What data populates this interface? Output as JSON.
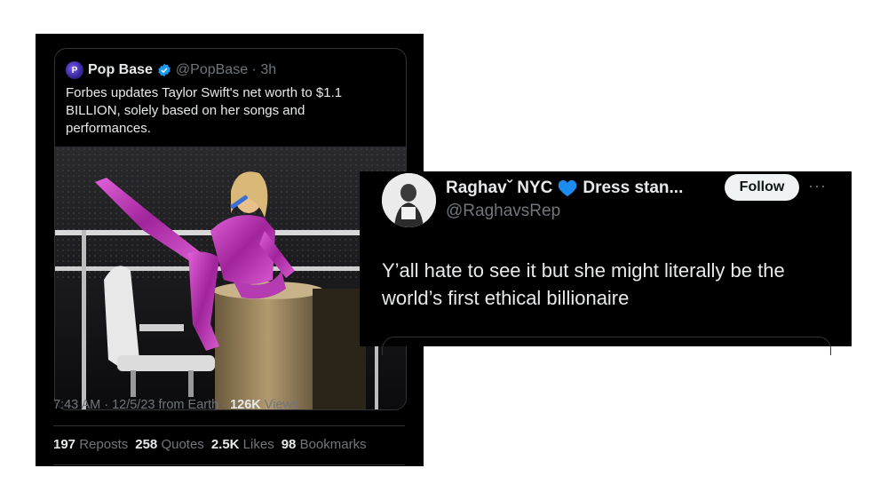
{
  "quote_tweet": {
    "avatar_initial": "P",
    "name": "Pop Base",
    "handle_time": "@PopBase · 3h",
    "text": "Forbes updates Taylor Swift's net worth to $1.1 BILLION, solely based on her songs and performances."
  },
  "meta": {
    "time_date": "7:43 AM · 12/5/23 from Earth · ",
    "views_count": "126K",
    "views_label": " Views"
  },
  "stats": {
    "reposts_count": "197",
    "reposts_label": "Reposts",
    "quotes_count": "258",
    "quotes_label": "Quotes",
    "likes_count": "2.5K",
    "likes_label": "Likes",
    "bookmarks_count": "98",
    "bookmarks_label": "Bookmarks"
  },
  "reply": {
    "name": "Raghavˇ NYC",
    "name_suffix": "Dress stan...",
    "handle": "@RaghavsRep",
    "follow_label": "Follow",
    "more_label": "···",
    "text": "Y’all hate to see it but she might literally be the world’s first ethical billionaire"
  },
  "colors": {
    "background": "#000000",
    "primary_text": "#e7e9ea",
    "secondary_text": "#71767b",
    "verified_blue": "#1d9bf0",
    "heart_blue": "#1d8cf0"
  },
  "icons": {
    "verified": "verified-badge-icon",
    "heart": "blue-heart-icon",
    "more": "more-icon"
  }
}
